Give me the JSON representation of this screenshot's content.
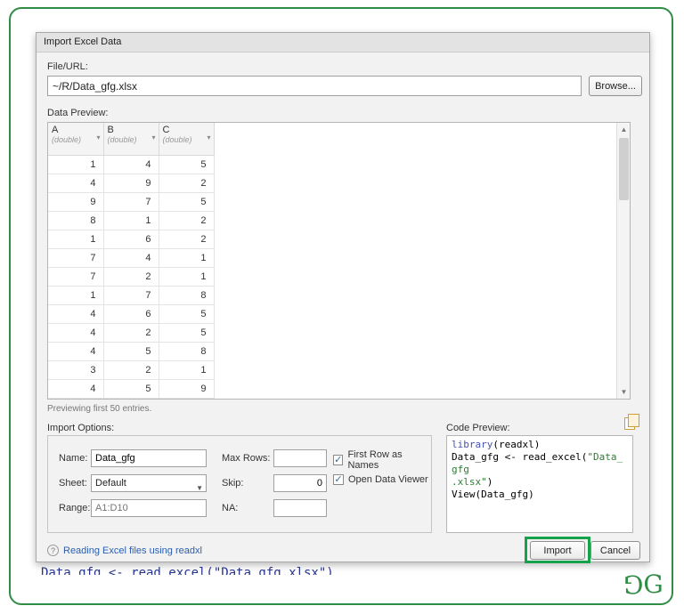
{
  "dialog": {
    "title": "Import Excel Data",
    "file_section": {
      "label": "File/URL:",
      "value": "~/R/Data_gfg.xlsx",
      "browse": "Browse..."
    },
    "preview": {
      "label": "Data Preview:",
      "note": "Previewing first 50 entries.",
      "columns": [
        {
          "name": "A",
          "type": "(double)"
        },
        {
          "name": "B",
          "type": "(double)"
        },
        {
          "name": "C",
          "type": "(double)"
        }
      ],
      "rows": [
        [
          1,
          4,
          5
        ],
        [
          4,
          9,
          2
        ],
        [
          9,
          7,
          5
        ],
        [
          8,
          1,
          2
        ],
        [
          1,
          6,
          2
        ],
        [
          7,
          4,
          1
        ],
        [
          7,
          2,
          1
        ],
        [
          1,
          7,
          8
        ],
        [
          4,
          6,
          5
        ],
        [
          4,
          2,
          5
        ],
        [
          4,
          5,
          8
        ],
        [
          3,
          2,
          1
        ],
        [
          4,
          5,
          9
        ]
      ]
    },
    "options": {
      "label": "Import Options:",
      "name_label": "Name:",
      "name_value": "Data_gfg",
      "sheet_label": "Sheet:",
      "sheet_value": "Default",
      "range_label": "Range:",
      "range_placeholder": "A1:D10",
      "max_rows_label": "Max Rows:",
      "max_rows_value": "",
      "skip_label": "Skip:",
      "skip_value": "0",
      "na_label": "NA:",
      "na_value": "",
      "checkbox_first_row": "First Row as Names",
      "checkbox_open_viewer": "Open Data Viewer"
    },
    "code_preview": {
      "label": "Code Preview:",
      "tokens": [
        {
          "t": "library",
          "c": "keyword"
        },
        {
          "t": "(readxl)\n",
          "c": "plain"
        },
        {
          "t": "Data_gfg <- read_excel(",
          "c": "plain"
        },
        {
          "t": "\"Data_gfg\n.xlsx\"",
          "c": "string"
        },
        {
          "t": ")\n",
          "c": "plain"
        },
        {
          "t": "View(Data_gfg)",
          "c": "plain"
        }
      ]
    },
    "footer": {
      "help_link": "Reading Excel files using readxl",
      "import": "Import",
      "cancel": "Cancel"
    }
  },
  "page": {
    "clipped_code": "Data_gfg <- read_excel(\"Data_gfg.xlsx\")",
    "logo_left": "G",
    "logo_right": "G"
  },
  "colors": {
    "accent_green": "#2f8d46",
    "keyword_blue": "#4254b5",
    "string_green": "#2e7d32"
  }
}
